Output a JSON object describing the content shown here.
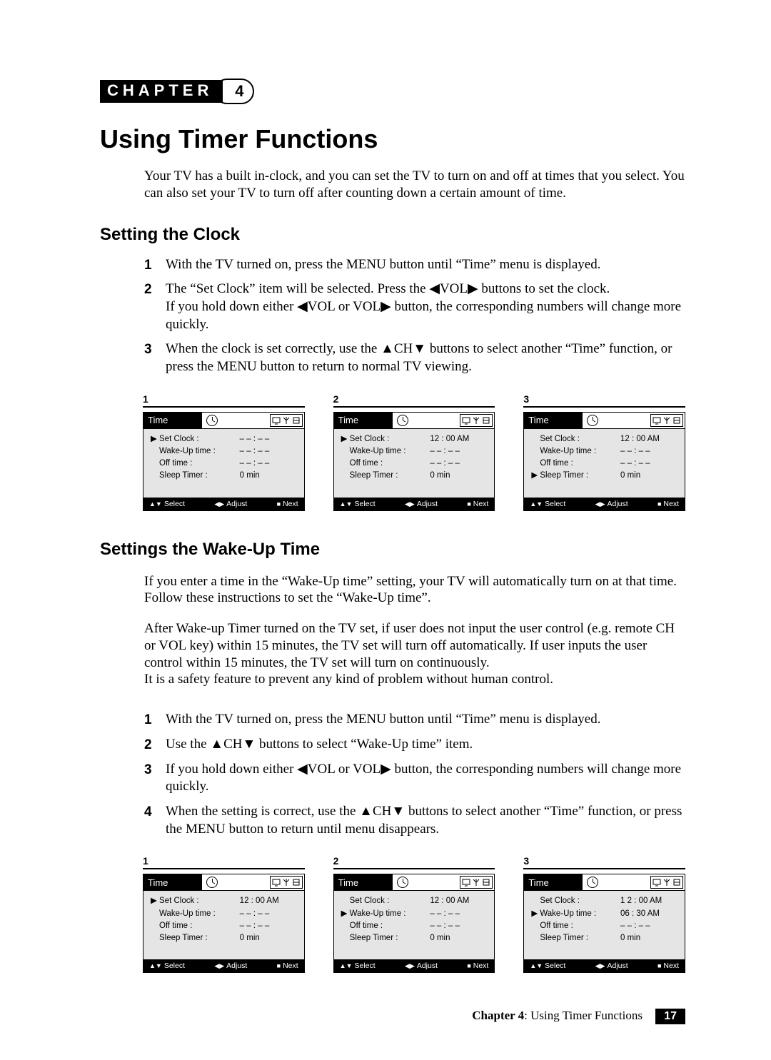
{
  "chapter": {
    "label": "CHAPTER",
    "number": "4"
  },
  "title": "Using Timer Functions",
  "intro": "Your TV has a built in-clock, and you can set the TV to turn on and off at times that you select. You can also set your TV to turn off after counting down a certain amount of time.",
  "sectionA": {
    "heading": "Setting the Clock",
    "steps": [
      "With the TV turned on, press the MENU button until “Time” menu is displayed.",
      "The “Set Clock” item will be selected. Press the ◀VOL▶ buttons to set the clock.\nIf you hold down either ◀VOL or VOL▶ button, the corresponding numbers will change more quickly.",
      "When the clock is set correctly, use the ▲CH▼ buttons to select another “Time” function, or press the MENU button to return to normal TV viewing."
    ],
    "menus": [
      {
        "num": "1",
        "rows": [
          {
            "sel": true,
            "label": "Set Clock :",
            "val": "– – : – –"
          },
          {
            "sel": false,
            "label": "Wake-Up time :",
            "val": "– – : – –"
          },
          {
            "sel": false,
            "label": "Off time :",
            "val": "– – : – –"
          },
          {
            "sel": false,
            "label": "Sleep Timer :",
            "val": "0 min"
          }
        ]
      },
      {
        "num": "2",
        "rows": [
          {
            "sel": true,
            "label": "Set Clock :",
            "val": "12 : 00 AM"
          },
          {
            "sel": false,
            "label": "Wake-Up time :",
            "val": "– – : – –"
          },
          {
            "sel": false,
            "label": "Off time :",
            "val": "– – : – –"
          },
          {
            "sel": false,
            "label": "Sleep Timer :",
            "val": "0 min"
          }
        ]
      },
      {
        "num": "3",
        "rows": [
          {
            "sel": false,
            "label": "Set Clock :",
            "val": "12 : 00 AM"
          },
          {
            "sel": false,
            "label": "Wake-Up time :",
            "val": "– – : – –"
          },
          {
            "sel": false,
            "label": "Off time :",
            "val": "– – : – –"
          },
          {
            "sel": true,
            "label": "Sleep Timer :",
            "val": "0 min"
          }
        ]
      }
    ]
  },
  "sectionB": {
    "heading": "Settings the Wake-Up Time",
    "para1": "If you enter a time in the “Wake-Up time” setting, your TV will automatically turn on at that time. Follow these instructions to set the “Wake-Up time”.",
    "para2": "After Wake-up Timer turned on the TV set, if user does not input the user control (e.g. remote CH or VOL key) within 15 minutes, the TV set will turn off automatically. If user inputs the user control within 15 minutes, the TV set will turn on continuously.\nIt is a safety feature to prevent any kind of problem without human control.",
    "steps": [
      "With the TV turned on, press the MENU button until “Time” menu is displayed.",
      "Use the ▲CH▼ buttons to select “Wake-Up time” item.",
      "If you hold down either ◀VOL or VOL▶ button, the corresponding numbers will change more quickly.",
      "When the setting is correct, use the ▲CH▼ buttons to select another “Time” function, or press the MENU button to return until menu disappears."
    ],
    "menus": [
      {
        "num": "1",
        "rows": [
          {
            "sel": true,
            "label": "Set Clock :",
            "val": "12 : 00 AM"
          },
          {
            "sel": false,
            "label": "Wake-Up time :",
            "val": "– – : – –"
          },
          {
            "sel": false,
            "label": "Off time :",
            "val": "– – : – –"
          },
          {
            "sel": false,
            "label": "Sleep Timer :",
            "val": "0 min"
          }
        ]
      },
      {
        "num": "2",
        "rows": [
          {
            "sel": false,
            "label": "Set Clock :",
            "val": "12 : 00 AM"
          },
          {
            "sel": true,
            "label": "Wake-Up time :",
            "val": "– – : – –"
          },
          {
            "sel": false,
            "label": "Off time :",
            "val": "– – : – –"
          },
          {
            "sel": false,
            "label": "Sleep Timer :",
            "val": "0 min"
          }
        ]
      },
      {
        "num": "3",
        "rows": [
          {
            "sel": false,
            "label": "Set Clock :",
            "val": "1 2 : 00 AM"
          },
          {
            "sel": true,
            "label": "Wake-Up time :",
            "val": "06 : 30 AM"
          },
          {
            "sel": false,
            "label": "Off time :",
            "val": "– – : – –"
          },
          {
            "sel": false,
            "label": "Sleep Timer :",
            "val": "0 min"
          }
        ]
      }
    ]
  },
  "osd": {
    "title": "Time",
    "footer": {
      "select": "Select",
      "adjust": "Adjust",
      "next": "Next"
    }
  },
  "footer": {
    "chapter_label": "Chapter 4",
    "chapter_title": ": Using Timer Functions",
    "page": "17"
  }
}
